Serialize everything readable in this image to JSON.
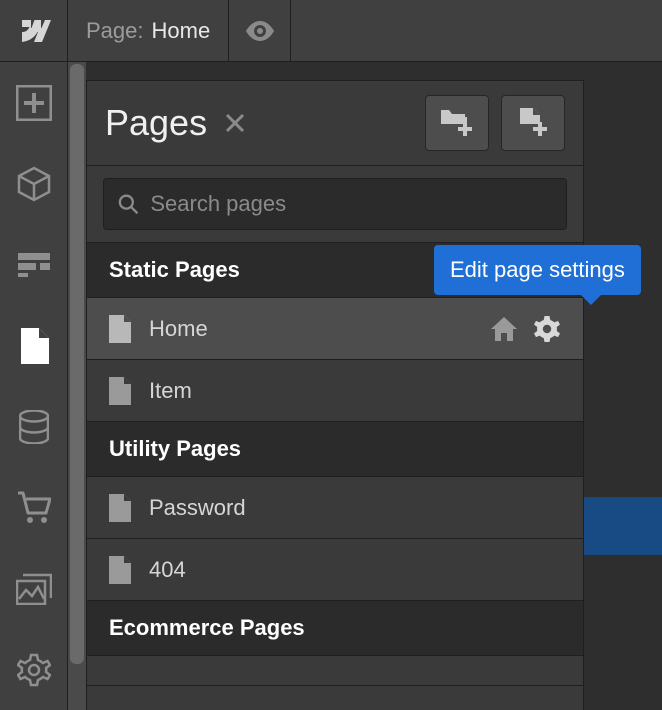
{
  "topbar": {
    "page_label": "Page:",
    "page_value": "Home"
  },
  "panel": {
    "title": "Pages",
    "search_placeholder": "Search pages",
    "sections": [
      {
        "title": "Static Pages",
        "items": [
          {
            "label": "Home",
            "hover": true,
            "is_home": true
          },
          {
            "label": "Item"
          }
        ]
      },
      {
        "title": "Utility Pages",
        "items": [
          {
            "label": "Password"
          },
          {
            "label": "404"
          }
        ]
      },
      {
        "title": "Ecommerce Pages",
        "items": []
      }
    ]
  },
  "tooltip": {
    "text": "Edit page settings"
  },
  "colors": {
    "accent": "#1f6fd6"
  }
}
